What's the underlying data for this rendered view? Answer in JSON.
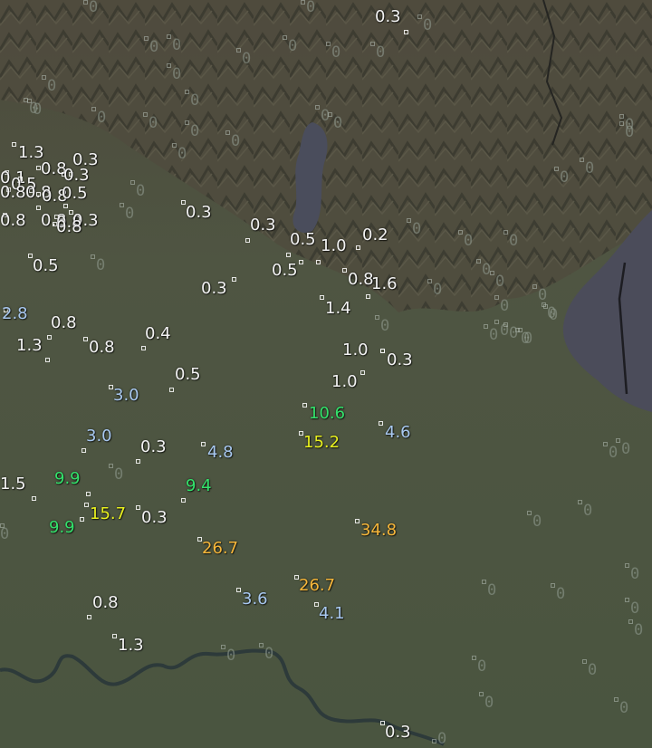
{
  "colors": {
    "light": "#f2f2f2",
    "blue": "#a8c8f0",
    "green": "#33e26b",
    "yellow": "#e8f01e",
    "orange": "#f6b63a"
  },
  "readings": [
    {
      "v": "0.3",
      "c": "light"
    },
    {
      "v": "1.3",
      "c": "light"
    },
    {
      "v": "0.8",
      "c": "light"
    },
    {
      "v": "0.3",
      "c": "light"
    },
    {
      "v": "0.1",
      "c": "light"
    },
    {
      "v": "0.5",
      "c": "light"
    },
    {
      "v": "0.8",
      "c": "light"
    },
    {
      "v": "0.3",
      "c": "light"
    },
    {
      "v": "0.8",
      "c": "light"
    },
    {
      "v": "0.8",
      "c": "light"
    },
    {
      "v": "0.8",
      "c": "light"
    },
    {
      "v": "0.5",
      "c": "light"
    },
    {
      "v": "0.8",
      "c": "light"
    },
    {
      "v": "0.8",
      "c": "light"
    },
    {
      "v": "0.3",
      "c": "light"
    },
    {
      "v": "0.8",
      "c": "light"
    },
    {
      "v": "0.3",
      "c": "light"
    },
    {
      "v": "0.3",
      "c": "light"
    },
    {
      "v": "0.5",
      "c": "light"
    },
    {
      "v": "1.0",
      "c": "light"
    },
    {
      "v": "0.2",
      "c": "light"
    },
    {
      "v": "0.5",
      "c": "light"
    },
    {
      "v": "0.5",
      "c": "light"
    },
    {
      "v": "0.8",
      "c": "light"
    },
    {
      "v": "1.6",
      "c": "light"
    },
    {
      "v": "0.3",
      "c": "light"
    },
    {
      "v": "1.4",
      "c": "light"
    },
    {
      "v": "2.8",
      "c": "blue"
    },
    {
      "v": "0.8",
      "c": "light"
    },
    {
      "v": "0.4",
      "c": "light"
    },
    {
      "v": "1.3",
      "c": "light"
    },
    {
      "v": "0.8",
      "c": "light"
    },
    {
      "v": "1.0",
      "c": "light"
    },
    {
      "v": "0.3",
      "c": "light"
    },
    {
      "v": "0.5",
      "c": "light"
    },
    {
      "v": "1.0",
      "c": "light"
    },
    {
      "v": "3.0",
      "c": "blue"
    },
    {
      "v": "10.6",
      "c": "green"
    },
    {
      "v": "15.2",
      "c": "yellow"
    },
    {
      "v": "4.6",
      "c": "blue"
    },
    {
      "v": "3.0",
      "c": "blue"
    },
    {
      "v": "0.3",
      "c": "light"
    },
    {
      "v": "4.8",
      "c": "blue"
    },
    {
      "v": "1.5",
      "c": "light"
    },
    {
      "v": "9.9",
      "c": "green"
    },
    {
      "v": "9.4",
      "c": "green"
    },
    {
      "v": "15.7",
      "c": "yellow"
    },
    {
      "v": "0.3",
      "c": "light"
    },
    {
      "v": "9.9",
      "c": "green"
    },
    {
      "v": "34.8",
      "c": "orange"
    },
    {
      "v": "26.7",
      "c": "orange"
    },
    {
      "v": "26.7",
      "c": "orange"
    },
    {
      "v": "3.6",
      "c": "blue"
    },
    {
      "v": "0.8",
      "c": "light"
    },
    {
      "v": "4.1",
      "c": "blue"
    },
    {
      "v": "1.3",
      "c": "light"
    },
    {
      "v": "0.3",
      "c": "light"
    }
  ],
  "zero_label": "0",
  "zero_count": 62
}
